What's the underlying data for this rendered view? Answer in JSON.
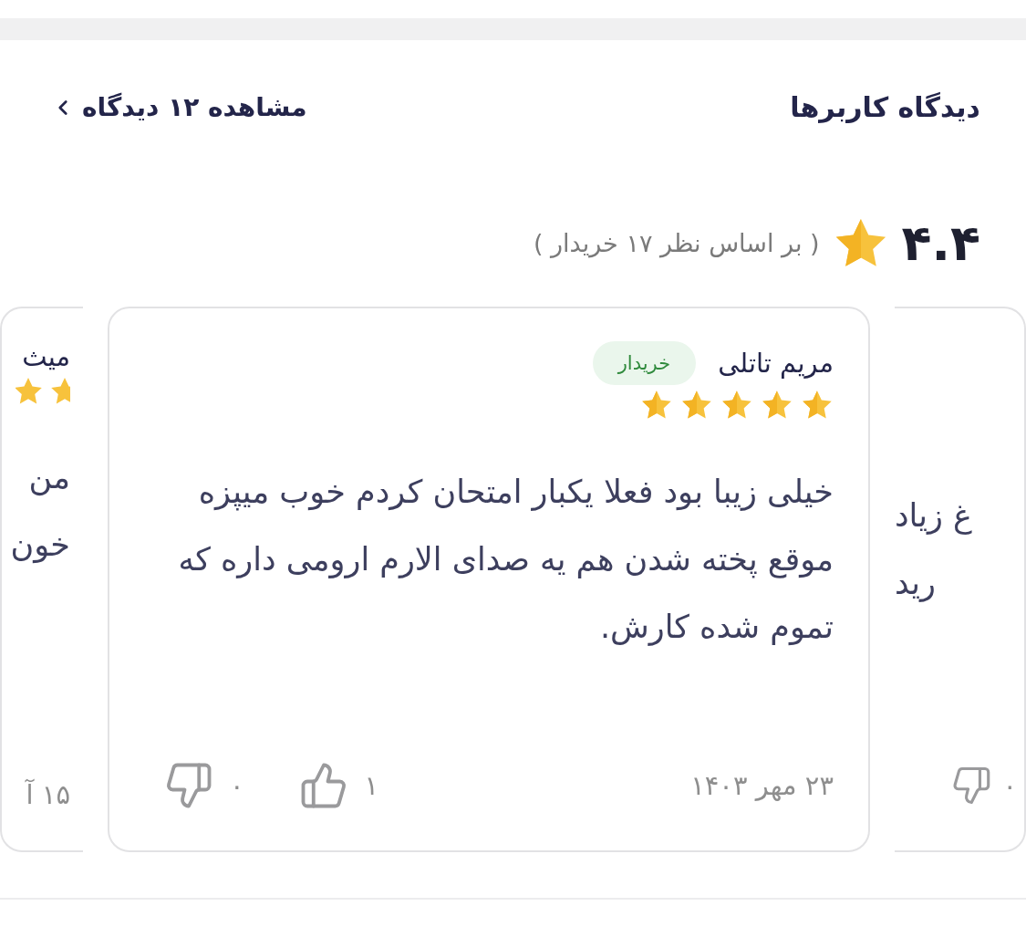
{
  "section": {
    "title": "دیدگاه کاربرها",
    "view_all": "مشاهده ۱۲ دیدگاه"
  },
  "summary": {
    "score": "۴.۴",
    "basis": "( بر اساس نظر ۱۷ خریدار )"
  },
  "reviews": [
    {
      "kind": "partial_right",
      "lines": [
        "غ زیاد",
        "رید"
      ],
      "dislikes": "۰"
    },
    {
      "kind": "full",
      "author": "مریم تاتلی",
      "badge": "خریدار",
      "stars": 5,
      "lines": [
        "خیلی زیبا بود فعلا یکبار امتحان کردم خوب میپزه",
        "موقع پخته شدن هم یه صدای الارم ارومی داره که",
        "تموم شده کارش."
      ],
      "date": "۲۳ مهر ۱۴۰۳",
      "likes": "۱",
      "dislikes": "۰"
    },
    {
      "kind": "partial_left",
      "author": "میث",
      "lines": [
        "من",
        "خون"
      ],
      "date": "۱۵ آ"
    }
  ]
}
